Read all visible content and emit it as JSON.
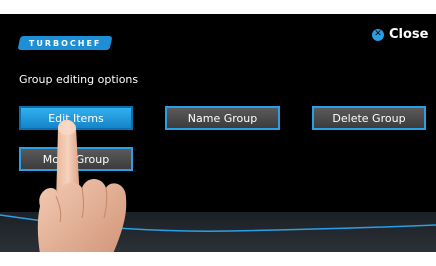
{
  "header": {
    "logo_text": "TURBOCHEF",
    "close_label": "Close"
  },
  "subtitle": "Group editing options",
  "buttons": {
    "edit_items": "Edit Items",
    "name_group": "Name Group",
    "delete_group": "Delete Group",
    "move_group": "Move Group"
  },
  "colors": {
    "accent": "#2b9fe4",
    "active_button": "#1d8fd6",
    "background": "#000000"
  }
}
